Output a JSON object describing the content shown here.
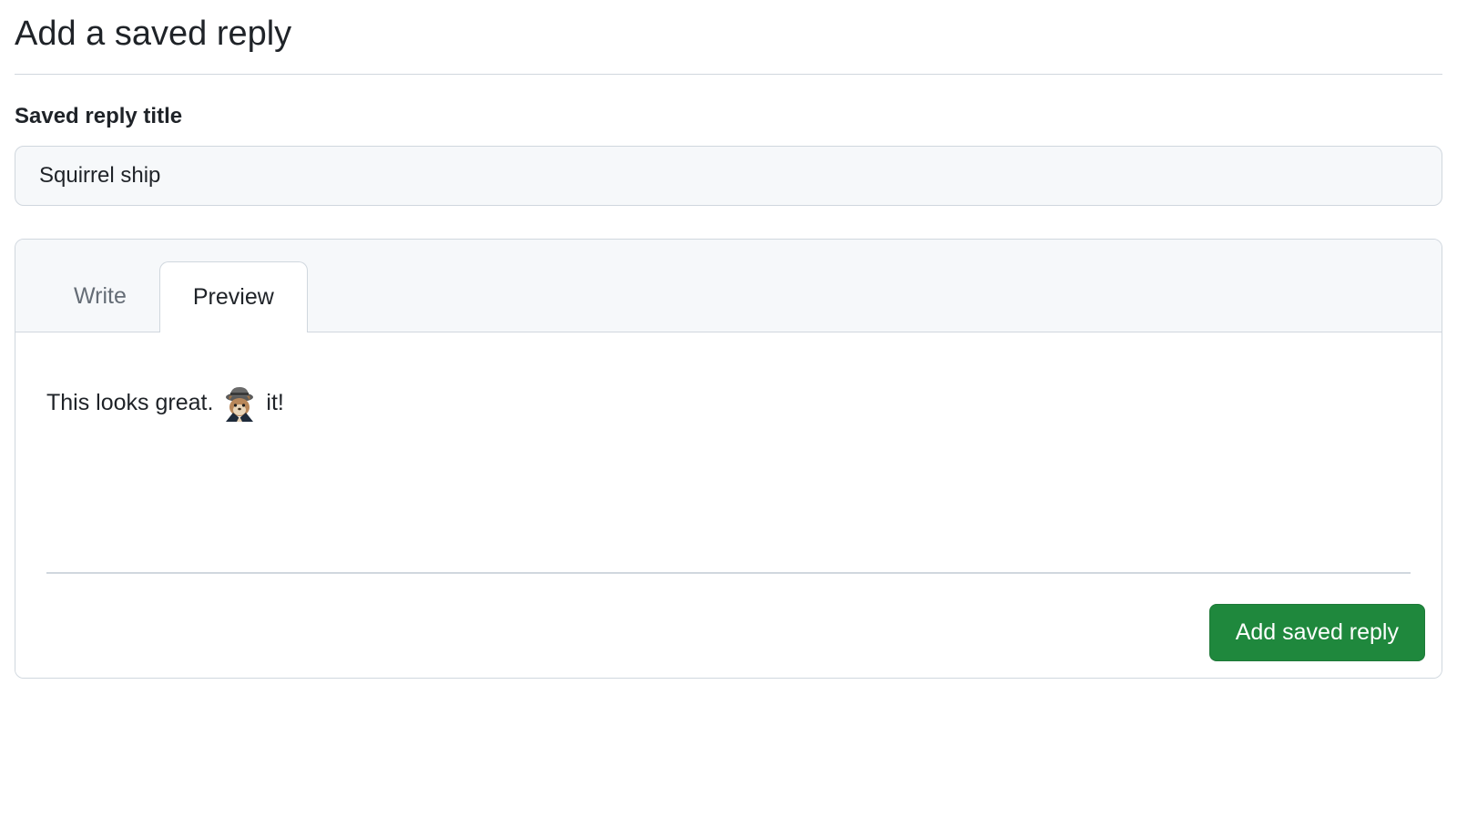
{
  "page": {
    "title": "Add a saved reply"
  },
  "form": {
    "title_label": "Saved reply title",
    "title_value": "Squirrel ship"
  },
  "editor": {
    "tabs": {
      "write": "Write",
      "preview": "Preview",
      "active": "preview"
    },
    "preview": {
      "text_before": "This looks great.",
      "emoji_name": "shipit-squirrel",
      "text_after": "it!"
    }
  },
  "actions": {
    "submit_label": "Add saved reply"
  }
}
